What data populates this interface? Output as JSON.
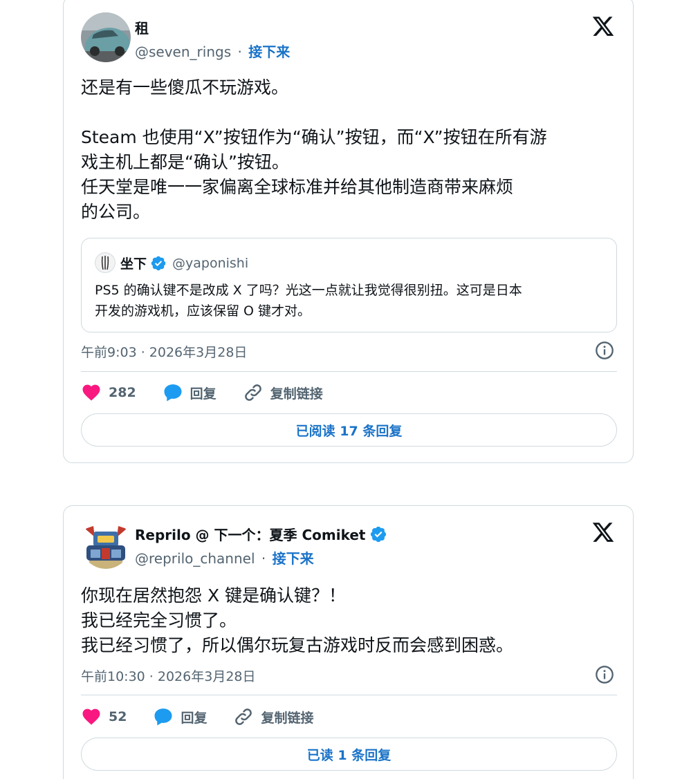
{
  "posts": [
    {
      "author_name": "租",
      "handle": "@seven_rings",
      "separator": "·",
      "follow_label": "接下来",
      "text_lines": [
        "还是有一些傻瓜不玩游戏。",
        "",
        "Steam 也使用“X”按钮作为“确认”按钮，而“X”按钮在所有游",
        "戏主机上都是“确认”按钮。",
        "任天堂是唯一一家偏离全球标准并给其他制造商带来麻烦",
        "的公司。"
      ],
      "quote": {
        "author_name": "坐下",
        "handle": "@yaponishi",
        "text_lines": [
          "PS5 的确认键不是改成 X 了吗？光这一点就让我觉得很别扭。这可是日本",
          "开发的游戏机，应该保留 O 键才对。"
        ]
      },
      "timestamp": "午前9:03 · 2026年3月28日",
      "likes": "282",
      "reply_label": "回复",
      "copy_link_label": "复制链接",
      "read_replies_label": "已阅读 17 条回复"
    },
    {
      "author_name": "Reprilo @ 下一个：夏季 Comiket",
      "handle": "@reprilo_channel",
      "separator": "·",
      "follow_label": "接下来",
      "text_lines": [
        "你现在居然抱怨 X 键是确认键？！",
        "我已经完全习惯了。",
        "我已经习惯了，所以偶尔玩复古游戏时反而会感到困惑。"
      ],
      "timestamp": "午前10:30 · 2026年3月28日",
      "likes": "52",
      "reply_label": "回复",
      "copy_link_label": "复制链接",
      "read_replies_label": "已读 1 条回复"
    }
  ],
  "icons": {
    "like": "heart-icon",
    "reply": "speech-bubble-icon",
    "copy_link": "link-icon",
    "info": "info-icon",
    "brand": "x-logo-icon",
    "verified": "verified-badge-icon"
  },
  "colors": {
    "like": "#f91880",
    "reply": "#1d9bf0",
    "link_blue": "#1a73c8",
    "secondary_text": "#536471",
    "border": "#cfd9de"
  }
}
